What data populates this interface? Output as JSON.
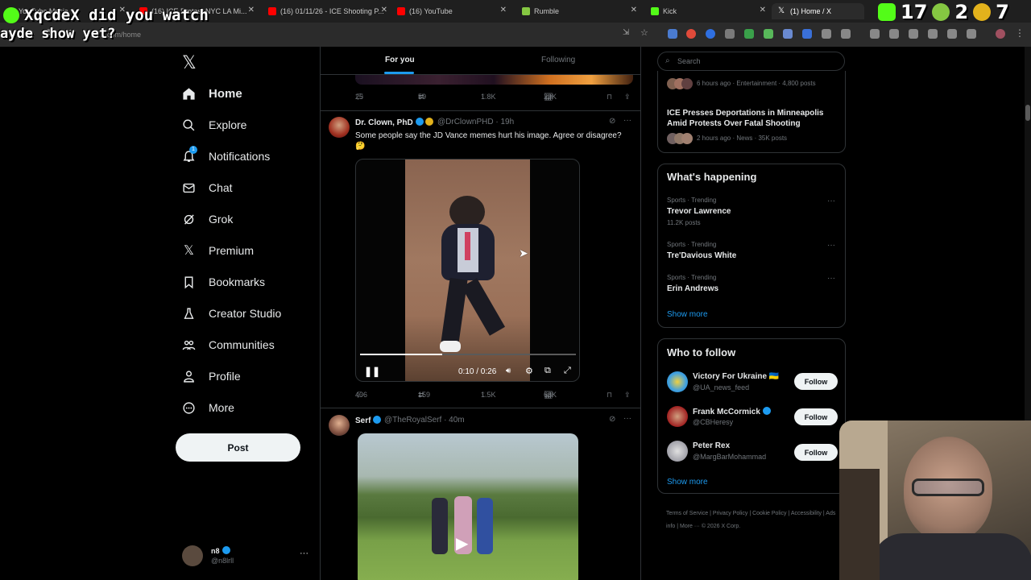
{
  "browser": {
    "tabs": [
      {
        "title": "YouTube Music",
        "favicon_color": "#ff0000"
      },
      {
        "title": "(16) ICE Protest NYC LA Mi...",
        "favicon_color": "#ff0000"
      },
      {
        "title": "(16) 01/11/26 - ICE Shooting P...",
        "favicon_color": "#ff0000"
      },
      {
        "title": "(16) YouTube",
        "favicon_color": "#ff0000"
      },
      {
        "title": "Rumble",
        "favicon_color": "#85c742"
      },
      {
        "title": "Kick",
        "favicon_color": "#53fc18"
      },
      {
        "title": "(1) Home / X",
        "favicon_color": "#ffffff"
      }
    ],
    "url": "x.com/home"
  },
  "overlay": {
    "line1": "XqcdeX did you watch",
    "line2": "ayde show yet?",
    "stats": [
      "17",
      "2",
      "7"
    ]
  },
  "nav": {
    "items": [
      {
        "label": "Home",
        "icon": "home-icon",
        "active": true
      },
      {
        "label": "Explore",
        "icon": "search-icon"
      },
      {
        "label": "Notifications",
        "icon": "bell-icon",
        "badge": "1"
      },
      {
        "label": "Chat",
        "icon": "mail-icon"
      },
      {
        "label": "Grok",
        "icon": "grok-icon"
      },
      {
        "label": "Premium",
        "icon": "x-logo-icon"
      },
      {
        "label": "Bookmarks",
        "icon": "bookmark-icon"
      },
      {
        "label": "Creator Studio",
        "icon": "flask-icon"
      },
      {
        "label": "Communities",
        "icon": "people-icon"
      },
      {
        "label": "Profile",
        "icon": "person-icon"
      },
      {
        "label": "More",
        "icon": "more-circle-icon"
      }
    ],
    "post_label": "Post",
    "account": {
      "name": "n8",
      "handle": "@n8lrll"
    }
  },
  "feed": {
    "tabs": [
      "For you",
      "Following"
    ],
    "top_actions": {
      "replies": "25",
      "reposts": "59",
      "likes": "1.8K",
      "views": "29K"
    },
    "tweet1": {
      "name": "Dr. Clown, PhD",
      "handle": "@DrClownPHD · 19h",
      "text": "Some people say the JD Vance memes hurt his image. Agree or disagree?",
      "emoji": "🤔",
      "video_time": "0:10 / 0:26",
      "video_progress": 0.38,
      "actions": {
        "replies": "406",
        "reposts": "159",
        "likes": "1.5K",
        "views": "66K"
      }
    },
    "tweet2": {
      "name": "Serf",
      "handle": "@TheRoyalSerf · 40m"
    }
  },
  "sidebar": {
    "search_placeholder": "Search",
    "news": [
      {
        "meta": "6 hours ago · Entertainment · 4,800 posts"
      },
      {
        "title": "ICE Presses Deportations in Minneapolis Amid Protests Over Fatal Shooting",
        "meta": "2 hours ago · News · 35K posts"
      }
    ],
    "happening_title": "What's happening",
    "trends": [
      {
        "category": "Sports · Trending",
        "name": "Trevor Lawrence",
        "count": "11.2K posts"
      },
      {
        "category": "Sports · Trending",
        "name": "Tre'Davious White",
        "count": ""
      },
      {
        "category": "Sports · Trending",
        "name": "Erin Andrews",
        "count": ""
      }
    ],
    "show_more": "Show more",
    "wtf_title": "Who to follow",
    "who_to_follow": [
      {
        "name": "Victory For Ukraine 🇺🇦",
        "handle": "@UA_news_feed",
        "button": "Follow"
      },
      {
        "name": "Frank McCormick",
        "handle": "@CBHeresy",
        "button": "Follow"
      },
      {
        "name": "Peter Rex",
        "handle": "@MargBarMohammad",
        "button": "Follow"
      }
    ],
    "footer": "Terms of Service | Privacy Policy | Cookie Policy | Accessibility | Ads info | More ··· © 2026 X Corp."
  }
}
